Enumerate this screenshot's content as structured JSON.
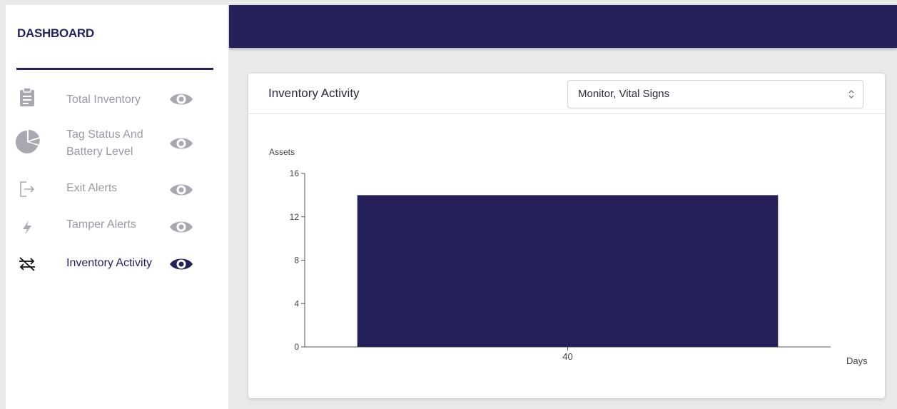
{
  "sidebar": {
    "title": "DASHBOARD",
    "items": [
      {
        "label": "Total Inventory",
        "icon": "clipboard-icon",
        "active": false
      },
      {
        "label": "Tag Status And Battery Level",
        "label_line1": "Tag Status And",
        "label_line2": "Battery Level",
        "icon": "pie-chart-icon",
        "active": false
      },
      {
        "label": "Exit Alerts",
        "icon": "exit-icon",
        "active": false
      },
      {
        "label": "Tamper Alerts",
        "icon": "lightning-icon",
        "active": false
      },
      {
        "label": "Inventory Activity",
        "icon": "crossed-arrows-icon",
        "active": true
      }
    ]
  },
  "colors": {
    "brand": "#24215a",
    "inactive": "#9a9aa6",
    "background": "#e9e9ea"
  },
  "card": {
    "title": "Inventory Activity",
    "select_value": "Monitor, Vital Signs"
  },
  "chart_data": {
    "type": "bar",
    "categories": [
      "40"
    ],
    "values": [
      14
    ],
    "xlabel": "Days",
    "ylabel": "Assets",
    "ylim": [
      0,
      16
    ],
    "yticks": [
      0,
      4,
      8,
      12,
      16
    ],
    "grid": false,
    "color": "#24215a"
  }
}
